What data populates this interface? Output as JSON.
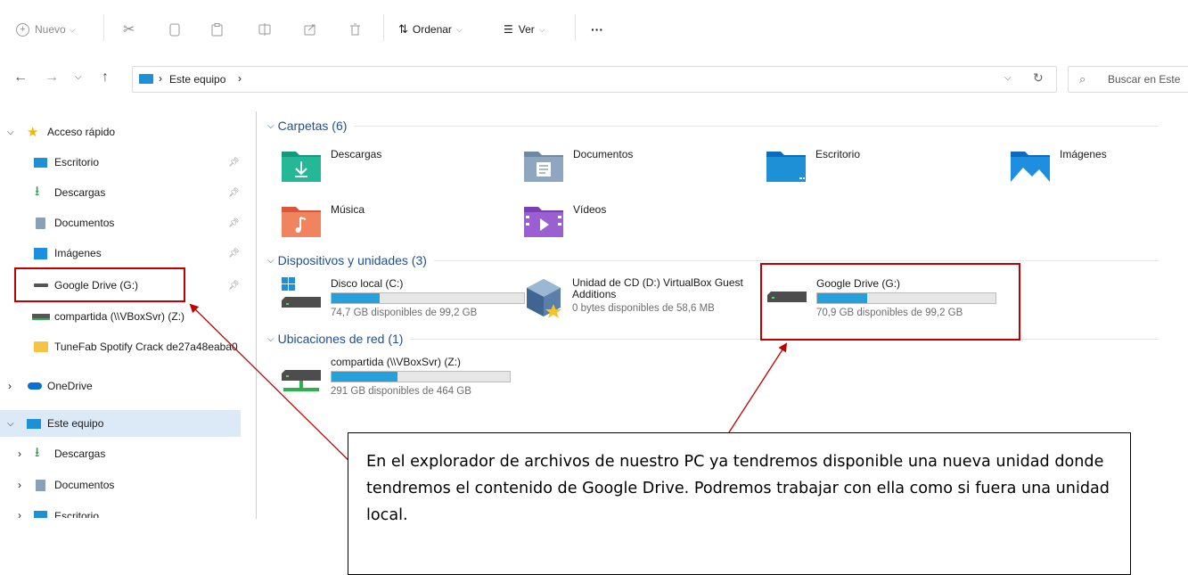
{
  "toolbar": {
    "new_label": "Nuevo",
    "sort_label": "Ordenar",
    "view_label": "Ver",
    "more_label": "···"
  },
  "address": {
    "path": "Este equipo",
    "search_placeholder": "Buscar en Este"
  },
  "sidebar": {
    "quick_access": "Acceso rápido",
    "items": [
      {
        "label": "Escritorio"
      },
      {
        "label": "Descargas"
      },
      {
        "label": "Documentos"
      },
      {
        "label": "Imágenes"
      },
      {
        "label": "Google Drive (G:)"
      },
      {
        "label": "compartida (\\\\VBoxSvr) (Z:)"
      },
      {
        "label": "TuneFab Spotify Crack de27a48eaba0"
      }
    ],
    "onedrive": "OneDrive",
    "this_pc": "Este equipo",
    "pc_items": [
      {
        "label": "Descargas"
      },
      {
        "label": "Documentos"
      },
      {
        "label": "Escritorio"
      }
    ]
  },
  "sections": {
    "folders": "Carpetas (6)",
    "devices": "Dispositivos y unidades (3)",
    "network": "Ubicaciones de red (1)"
  },
  "folders": [
    {
      "label": "Descargas"
    },
    {
      "label": "Documentos"
    },
    {
      "label": "Escritorio"
    },
    {
      "label": "Imágenes"
    },
    {
      "label": "Música"
    },
    {
      "label": "Vídeos"
    }
  ],
  "drives": [
    {
      "name": "Disco local (C:)",
      "free": "74,7 GB disponibles de 99,2 GB",
      "used_fraction": 0.25
    },
    {
      "name": "Unidad de CD (D:) VirtualBox Guest Additions",
      "free": "0 bytes disponibles de 58,6 MB"
    },
    {
      "name": "Google Drive (G:)",
      "free": "70,9 GB disponibles de 99,2 GB",
      "used_fraction": 0.28
    }
  ],
  "network": [
    {
      "name": "compartida (\\\\VBoxSvr) (Z:)",
      "free": "291 GB disponibles de 464 GB",
      "used_fraction": 0.37
    }
  ],
  "annotation": "En el explorador de archivos de nuestro PC ya tendremos disponible una nueva unidad donde tendremos el contenido de Google Drive. Podremos trabajar con ella como si fuera una unidad local.",
  "colors": {
    "accent": "#26a0da",
    "highlight": "#c00000",
    "selection": "#dce9f7"
  }
}
